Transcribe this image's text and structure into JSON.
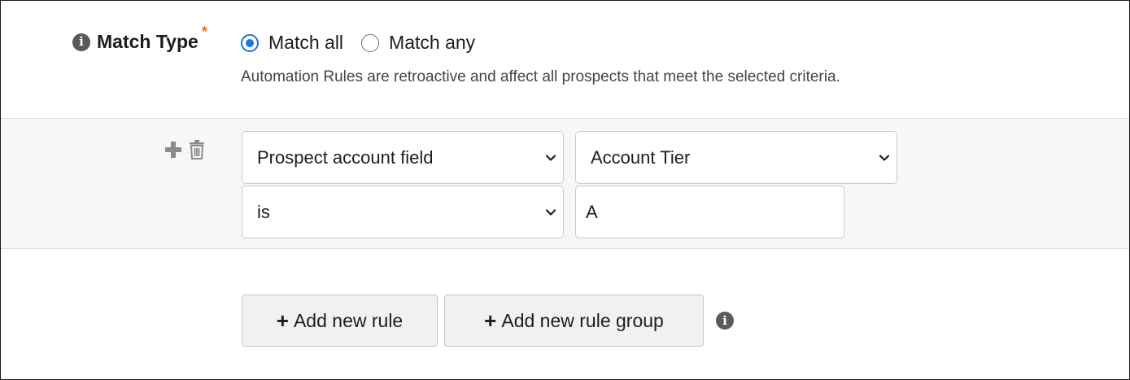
{
  "match_type": {
    "label": "Match Type",
    "required_marker": "*",
    "info_icon": "info-icon",
    "options": [
      {
        "label": "Match all",
        "selected": true
      },
      {
        "label": "Match any",
        "selected": false
      }
    ],
    "help_text": "Automation Rules are retroactive and affect all prospects that meet the selected criteria."
  },
  "rule_group": {
    "actions": {
      "add_icon": "plus-icon",
      "delete_icon": "trash-icon"
    },
    "rule": {
      "field_type": "Prospect account field",
      "field": "Account Tier",
      "operator": "is",
      "value": "A"
    }
  },
  "buttons": {
    "add_rule_icon": "+",
    "add_rule": "Add new rule",
    "add_rule_group_icon": "+",
    "add_rule_group": "Add new rule group",
    "info_icon": "info-icon"
  },
  "colors": {
    "accent": "#1a73e8",
    "required": "#e07a1f",
    "group_background": "#f7f7f7"
  }
}
